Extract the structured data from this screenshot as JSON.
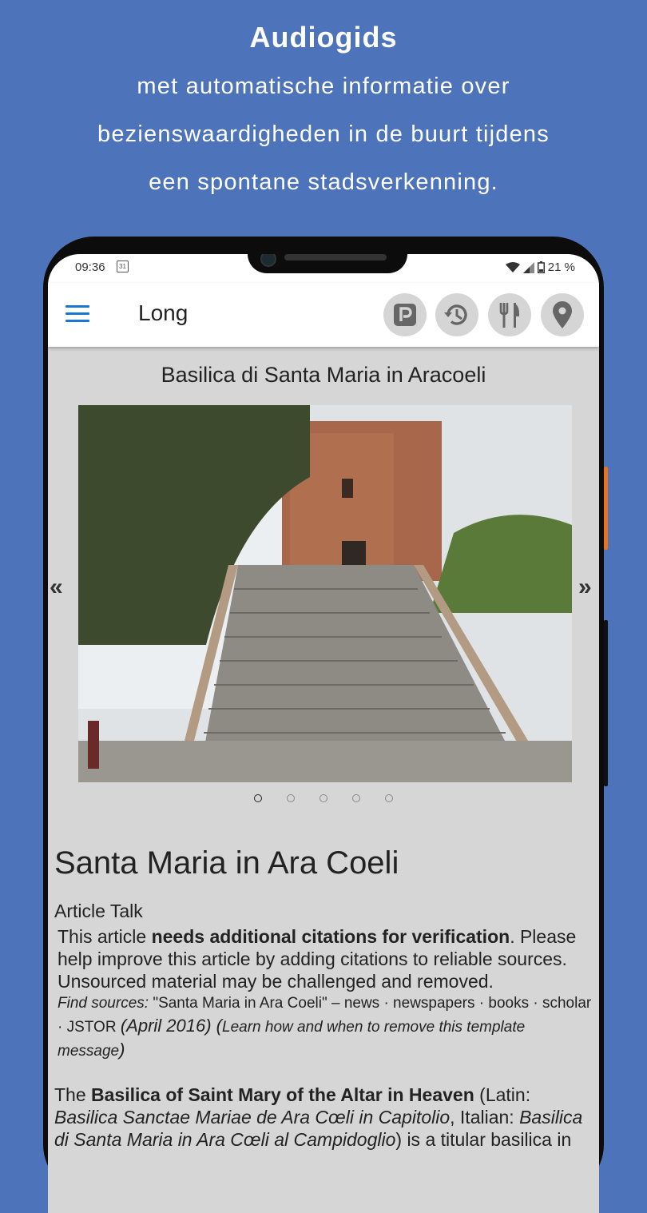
{
  "promo": {
    "title": "Audiogids",
    "line1": "met automatische informatie over",
    "line2": "bezienswaardigheden in de buurt tijdens",
    "line3": "een spontane stadsverkenning."
  },
  "statusbar": {
    "time": "09:36",
    "calendar_day": "31",
    "battery": "21 %"
  },
  "appbar": {
    "title": "Long",
    "buttons": [
      "parking-icon",
      "history-icon",
      "restaurant-icon",
      "location-icon"
    ]
  },
  "place": {
    "title": "Basilica di Santa Maria in Aracoeli",
    "prev_arrow": "«",
    "next_arrow": "»",
    "slide_count": 5,
    "active_slide": 0
  },
  "article": {
    "heading": "Santa Maria in Ara Coeli",
    "tabs": "Article Talk",
    "notice_pre": "This article ",
    "notice_bold": "needs additional citations for verification",
    "notice_post": ". Please help improve this article by adding citations to reliable sources. Unsourced material may be challenged and removed.",
    "find_label": "Find sources:",
    "find_text": " \"Santa Maria in Ara Coeli\" – news · newspapers · books · scholar · JSTOR ",
    "find_date": "(April 2016)",
    "find_note_open": " (",
    "find_note": "Learn how and when to remove this template message",
    "find_note_close": ")",
    "para_pre": "The ",
    "para_bold": "Basilica of Saint Mary of the Altar in Heaven",
    "para_mid1": " (Latin: ",
    "para_latin": "Basilica Sanctae Mariae de Ara Cœli in Capitolio",
    "para_mid2": ", Italian: ",
    "para_italian": "Basilica di Santa Maria in Ara Cœli al Campidoglio",
    "para_end": ") is a titular basilica in"
  },
  "colors": {
    "background": "#4d74bb",
    "accent": "#1976d2",
    "side_button": "#e8731c"
  }
}
